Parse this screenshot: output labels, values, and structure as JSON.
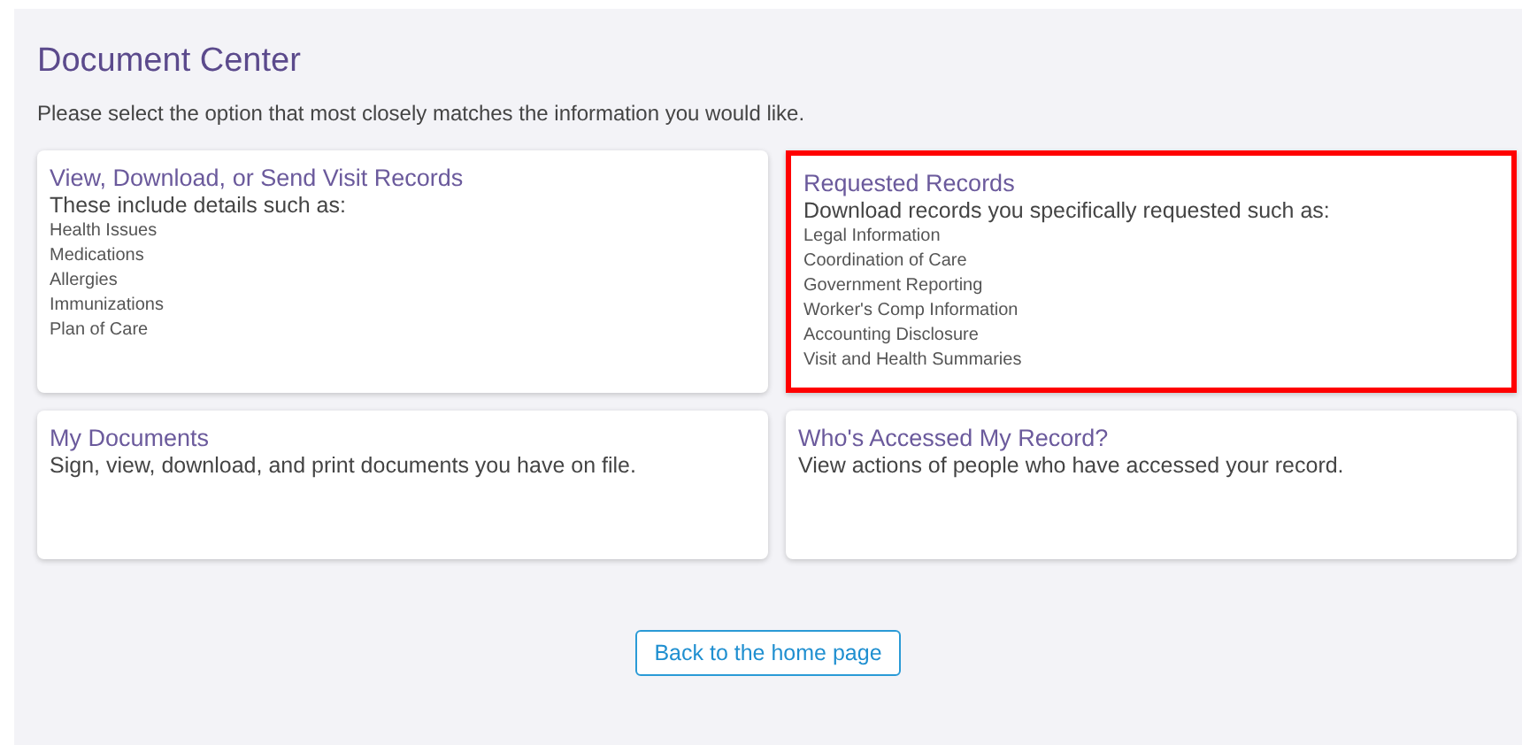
{
  "page": {
    "title": "Document Center",
    "intro": "Please select the option that most closely matches the information you would like."
  },
  "cards": [
    {
      "title": "View, Download, or Send Visit Records",
      "description": "These include details such as:",
      "items": [
        "Health Issues",
        "Medications",
        "Allergies",
        "Immunizations",
        "Plan of Care"
      ],
      "highlighted": false
    },
    {
      "title": "Requested Records",
      "description": "Download records you specifically requested such as:",
      "items": [
        "Legal Information",
        "Coordination of Care",
        "Government Reporting",
        "Worker's Comp Information",
        "Accounting Disclosure",
        "Visit and Health Summaries"
      ],
      "highlighted": true
    },
    {
      "title": "My Documents",
      "description": "Sign, view, download, and print documents you have on file.",
      "highlighted": false
    },
    {
      "title": "Who's Accessed My Record?",
      "description": "View actions of people who have accessed your record.",
      "highlighted": false
    }
  ],
  "back_button": {
    "label": "Back to the home page"
  }
}
